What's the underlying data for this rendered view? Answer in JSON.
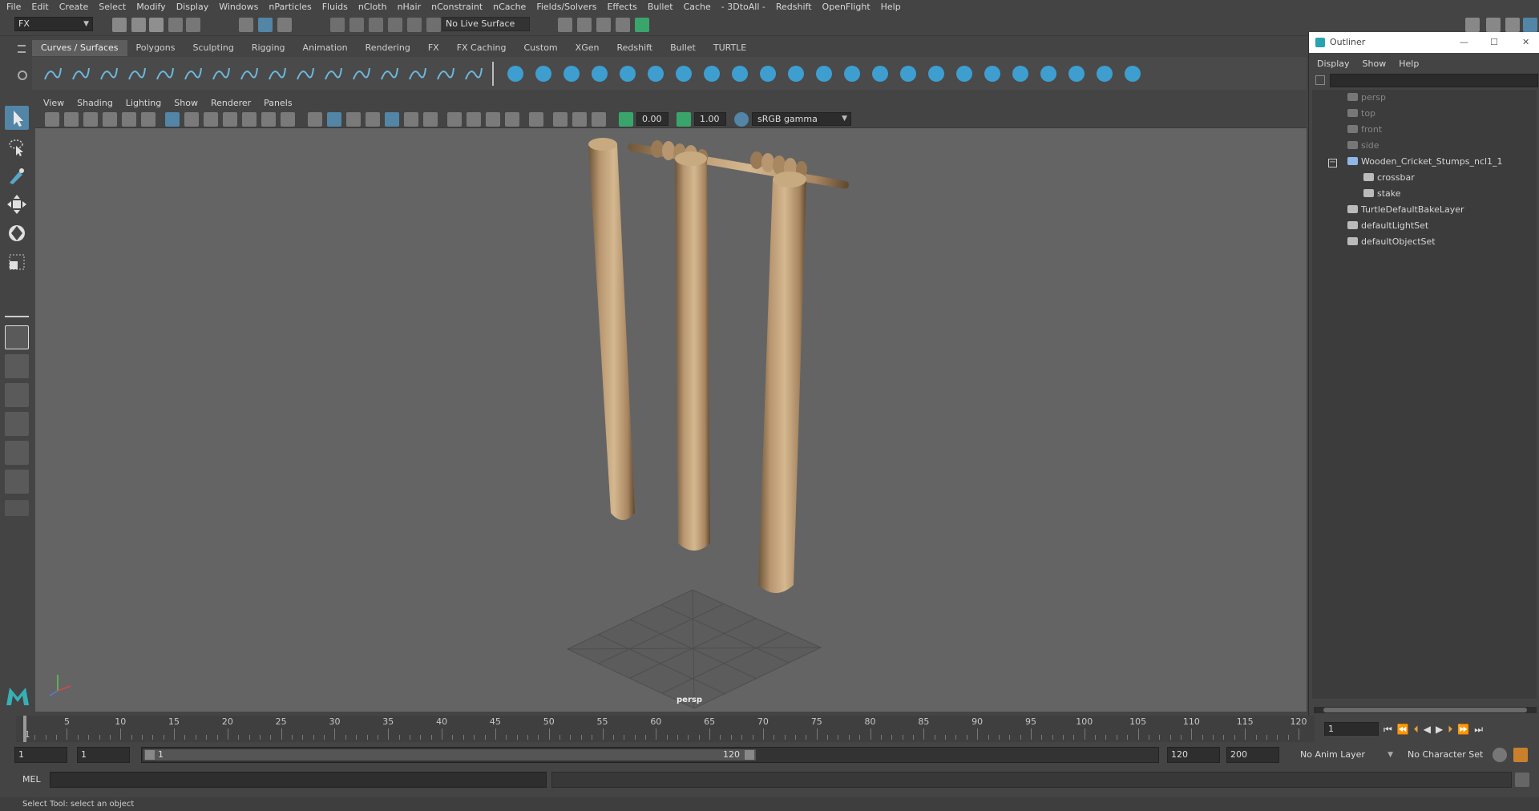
{
  "menubar": [
    "File",
    "Edit",
    "Create",
    "Select",
    "Modify",
    "Display",
    "Windows",
    "nParticles",
    "Fluids",
    "nCloth",
    "nHair",
    "nConstraint",
    "nCache",
    "Fields/Solvers",
    "Effects",
    "Bullet",
    "Cache",
    "- 3DtoAll -",
    "Redshift",
    "OpenFlight",
    "Help"
  ],
  "status": {
    "mode": "FX",
    "live_surface": "No Live Surface"
  },
  "shelf_tabs": [
    "Curves / Surfaces",
    "Polygons",
    "Sculpting",
    "Rigging",
    "Animation",
    "Rendering",
    "FX",
    "FX Caching",
    "Custom",
    "XGen",
    "Redshift",
    "Bullet",
    "TURTLE"
  ],
  "viewport": {
    "menu": [
      "View",
      "Shading",
      "Lighting",
      "Show",
      "Renderer",
      "Panels"
    ],
    "exposure": "0.00",
    "gamma": "1.00",
    "color_space": "sRGB gamma",
    "camera_label": "persp"
  },
  "outliner": {
    "title": "Outliner",
    "menu": [
      "Display",
      "Show",
      "Help"
    ],
    "items": [
      {
        "label": "persp",
        "icon": "camera-icon",
        "dim": true
      },
      {
        "label": "top",
        "icon": "camera-icon",
        "dim": true
      },
      {
        "label": "front",
        "icon": "camera-icon",
        "dim": true
      },
      {
        "label": "side",
        "icon": "camera-icon",
        "dim": true
      },
      {
        "label": "Wooden_Cricket_Stumps_ncl1_1",
        "icon": "group-icon",
        "dim": false
      },
      {
        "label": "crossbar",
        "icon": "mesh-icon",
        "dim": false
      },
      {
        "label": "stake",
        "icon": "mesh-icon",
        "dim": false
      },
      {
        "label": "TurtleDefaultBakeLayer",
        "icon": "bake-layer-icon",
        "dim": false
      },
      {
        "label": "defaultLightSet",
        "icon": "set-icon",
        "dim": false
      },
      {
        "label": "defaultObjectSet",
        "icon": "set-icon",
        "dim": false
      }
    ]
  },
  "timeline": {
    "labels": [
      "1",
      "5",
      "10",
      "15",
      "20",
      "25",
      "30",
      "35",
      "40",
      "45",
      "50",
      "55",
      "60",
      "65",
      "70",
      "75",
      "80",
      "85",
      "90",
      "95",
      "100",
      "105",
      "110",
      "115",
      "120"
    ],
    "current_frame": "1"
  },
  "range": {
    "start": "1",
    "playback_start": "1",
    "slider_start": "1",
    "slider_end": "120",
    "playback_end": "120",
    "end": "200",
    "anim_layer": "No Anim Layer",
    "character_set": "No Character Set"
  },
  "command": {
    "label": "MEL"
  },
  "help_line": "Select Tool: select an object",
  "colors": {
    "accent": "#5285a6",
    "wood": "#b89670",
    "viewport_bg": "#646464"
  }
}
